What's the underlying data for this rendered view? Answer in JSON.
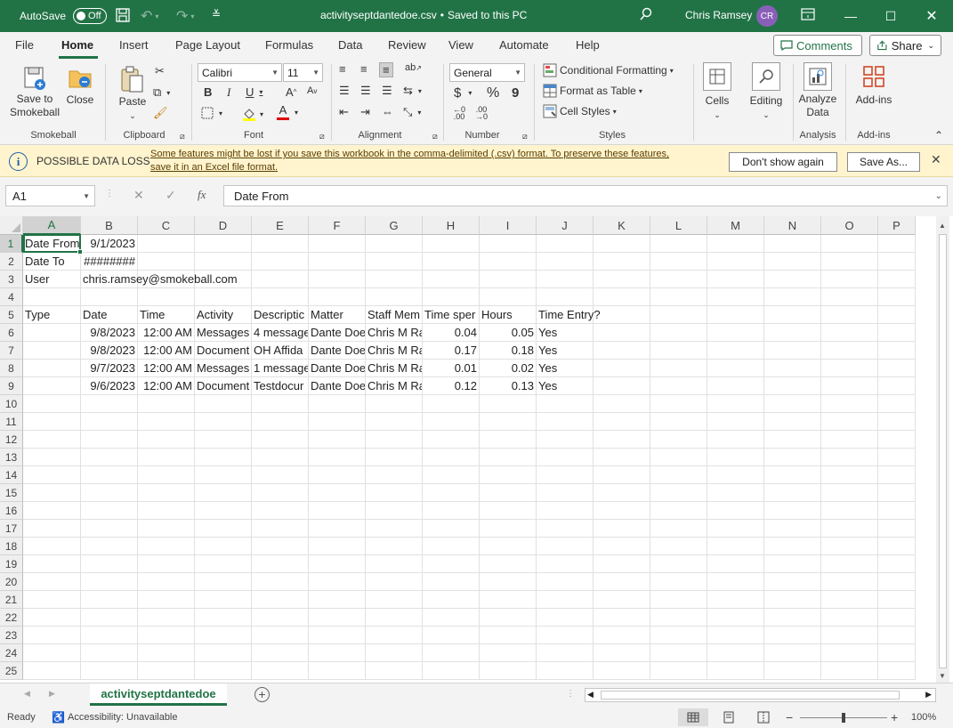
{
  "titlebar": {
    "autosave_label": "AutoSave",
    "autosave_state": "Off",
    "filename": "activityseptdantedoe.csv",
    "save_status": "Saved to this PC",
    "user_name": "Chris Ramsey",
    "user_initials": "CR",
    "accent": "#217346"
  },
  "menu": {
    "items": [
      "File",
      "Home",
      "Insert",
      "Page Layout",
      "Formulas",
      "Data",
      "Review",
      "View",
      "Automate",
      "Help"
    ],
    "active": "Home",
    "comments_label": "Comments",
    "share_label": "Share"
  },
  "ribbon": {
    "smokeball": {
      "save_label": "Save to\nSmokeball",
      "close_label": "Close",
      "group": "Smokeball"
    },
    "clipboard": {
      "paste_label": "Paste",
      "group": "Clipboard"
    },
    "font": {
      "name": "Calibri",
      "size": "11",
      "group": "Font"
    },
    "alignment": {
      "group": "Alignment"
    },
    "number": {
      "format": "General",
      "group": "Number"
    },
    "styles": {
      "conditional": "Conditional Formatting",
      "format_table": "Format as Table",
      "cell_styles": "Cell Styles",
      "group": "Styles"
    },
    "cells": {
      "label": "Cells"
    },
    "editing": {
      "label": "Editing"
    },
    "analysis": {
      "analyze_label": "Analyze\nData",
      "group": "Analysis"
    },
    "addins": {
      "label": "Add-ins",
      "group": "Add-ins"
    }
  },
  "infobar": {
    "title": "POSSIBLE DATA LOSS",
    "message_line1": "Some features might be lost if you save this workbook in the comma-delimited (.csv) format. To preserve these features,",
    "message_line2": "save it in an Excel file format.",
    "dont_show_label": "Don't show again",
    "save_as_label": "Save As..."
  },
  "formula_bar": {
    "name_box": "A1",
    "fx": "fx",
    "content": "Date From"
  },
  "sheet": {
    "columns": [
      "A",
      "B",
      "C",
      "D",
      "E",
      "F",
      "G",
      "H",
      "I",
      "J",
      "K",
      "L",
      "M",
      "N",
      "O",
      "P"
    ],
    "row_numbers": [
      "1",
      "2",
      "3",
      "4",
      "5",
      "6",
      "7",
      "8",
      "9",
      "10",
      "11",
      "12",
      "13",
      "14",
      "15",
      "16",
      "17",
      "18",
      "19",
      "20",
      "21",
      "22",
      "23",
      "24",
      "25"
    ],
    "rows": [
      [
        "Date From",
        "9/1/2023",
        "",
        "",
        "",
        "",
        "",
        "",
        "",
        ""
      ],
      [
        "Date To",
        "########",
        "",
        "",
        "",
        "",
        "",
        "",
        "",
        ""
      ],
      [
        "User",
        "chris.ramsey@smokeball.com",
        "",
        "",
        "",
        "",
        "",
        "",
        "",
        ""
      ],
      [
        "",
        "",
        "",
        "",
        "",
        "",
        "",
        "",
        "",
        ""
      ],
      [
        "Type",
        "Date",
        "Time",
        "Activity",
        "Descriptic",
        "Matter",
        "Staff Mem",
        "Time sper",
        "Hours",
        "Time Entry?"
      ],
      [
        "",
        "9/8/2023",
        "12:00 AM",
        "Messages",
        "4 message",
        "Dante Doe",
        "Chris M Ra",
        "0.04",
        "0.05",
        "Yes"
      ],
      [
        "",
        "9/8/2023",
        "12:00 AM",
        "Document",
        "OH Affida",
        "Dante Doe",
        "Chris M Ra",
        "0.17",
        "0.18",
        "Yes"
      ],
      [
        "",
        "9/7/2023",
        "12:00 AM",
        "Messages",
        "1 message",
        "Dante Doe",
        "Chris M Ra",
        "0.01",
        "0.02",
        "Yes"
      ],
      [
        "",
        "9/6/2023",
        "12:00 AM",
        "Document",
        "Testdocur",
        "Dante Doe",
        "Chris M Ra",
        "0.12",
        "0.13",
        "Yes"
      ]
    ]
  },
  "tabs": {
    "active_sheet": "activityseptdantedoe"
  },
  "status": {
    "ready": "Ready",
    "accessibility": "Accessibility: Unavailable",
    "zoom": "100%"
  }
}
